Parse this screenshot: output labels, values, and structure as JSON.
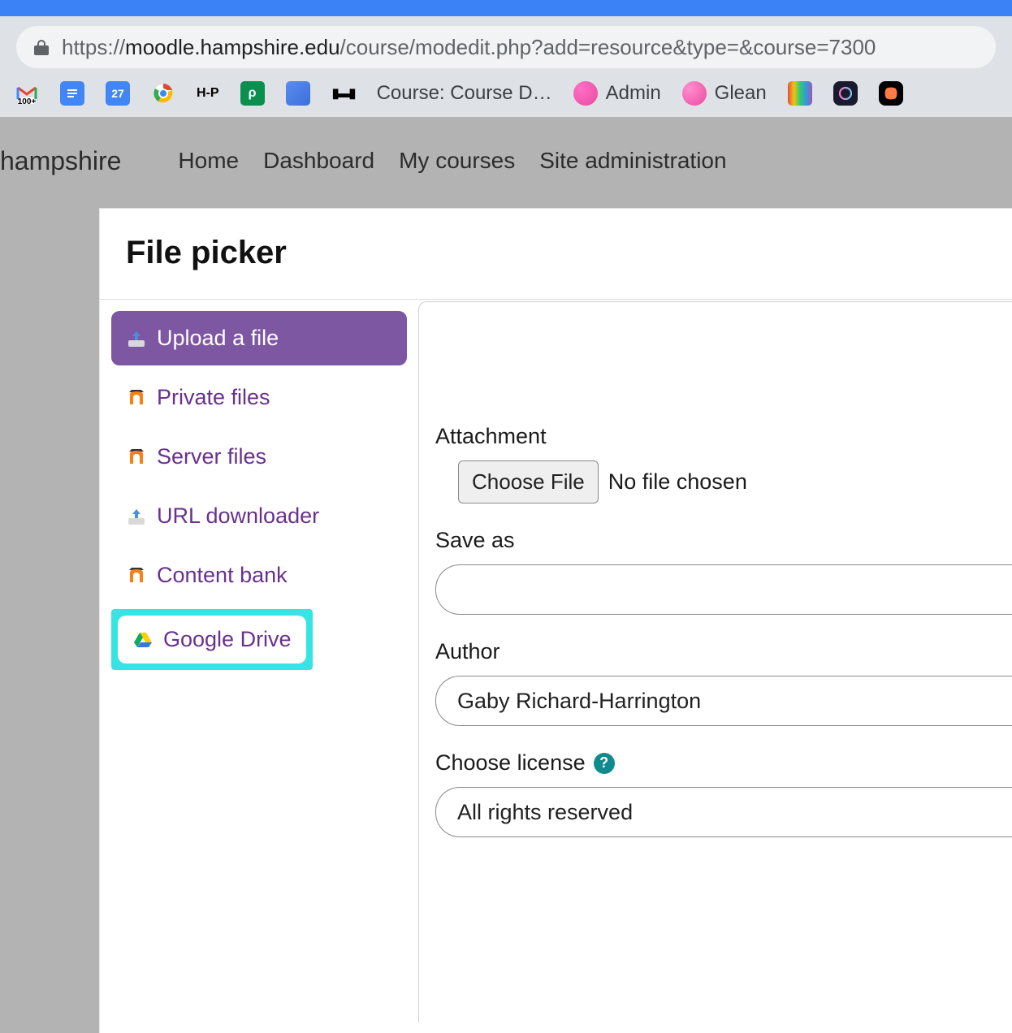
{
  "browser": {
    "url_prefix": "https://",
    "url_host": "moodle.hampshire.edu",
    "url_path": "/course/modedit.php?add=resource&type=&course=7300"
  },
  "bookmarks": [
    {
      "label": "",
      "icon": "gmail",
      "badge": "100+"
    },
    {
      "label": "",
      "icon": "docs"
    },
    {
      "label": "",
      "icon": "calendar",
      "badge": "27"
    },
    {
      "label": "",
      "icon": "chrome"
    },
    {
      "label": "",
      "icon": "h5p"
    },
    {
      "label": "",
      "icon": "green-p"
    },
    {
      "label": "",
      "icon": "blue-square"
    },
    {
      "label": "",
      "icon": "bars"
    },
    {
      "label": "Course: Course D…",
      "icon": "none"
    },
    {
      "label": "Admin",
      "icon": "pink-blob"
    },
    {
      "label": "Glean",
      "icon": "pink-blob2"
    },
    {
      "label": "",
      "icon": "rainbow"
    },
    {
      "label": "",
      "icon": "circle-o"
    },
    {
      "label": "",
      "icon": "black-shape"
    }
  ],
  "nav": {
    "brand": "hampshire",
    "links": [
      "Home",
      "Dashboard",
      "My courses",
      "Site administration"
    ]
  },
  "filepicker": {
    "title": "File picker",
    "repos": [
      {
        "label": "Upload a file",
        "icon": "upload",
        "active": true
      },
      {
        "label": "Private files",
        "icon": "moodle"
      },
      {
        "label": "Server files",
        "icon": "moodle"
      },
      {
        "label": "URL downloader",
        "icon": "download"
      },
      {
        "label": "Content bank",
        "icon": "moodle"
      },
      {
        "label": "Google Drive",
        "icon": "gdrive",
        "highlighted": true
      }
    ],
    "form": {
      "attachment_label": "Attachment",
      "choose_file": "Choose File",
      "no_file": "No file chosen",
      "saveas_label": "Save as",
      "saveas_value": "",
      "author_label": "Author",
      "author_value": "Gaby Richard-Harrington",
      "license_label": "Choose license",
      "license_value": "All rights reserved"
    }
  }
}
